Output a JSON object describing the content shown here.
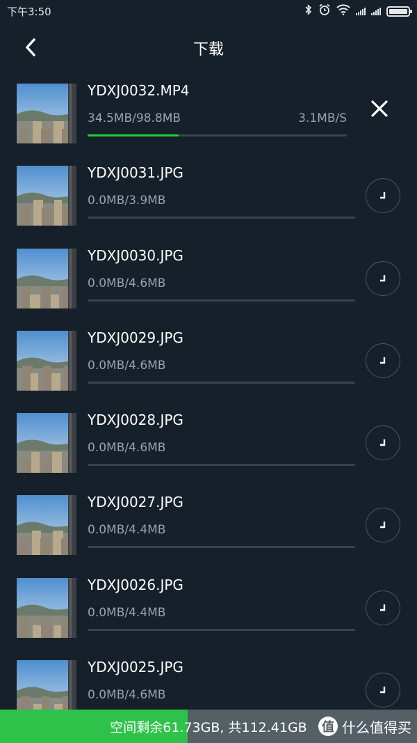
{
  "status_bar": {
    "time": "下午3:50",
    "icons": [
      "bluetooth-icon",
      "alarm-icon",
      "wifi-icon",
      "signal-icon",
      "signal-icon",
      "battery-icon"
    ]
  },
  "header": {
    "title": "下载",
    "back_icon": "chevron-left-icon"
  },
  "colors": {
    "background": "#16202a",
    "progress": "#27c93f",
    "storage_used": "#2ec24a",
    "storage_free": "#555f66"
  },
  "downloads": [
    {
      "name": "YDXJ0032.MP4",
      "size": "34.5MB/98.8MB",
      "speed": "3.1MB/S",
      "progress": 0.35,
      "state": "downloading",
      "action_icon": "close-icon"
    },
    {
      "name": "YDXJ0031.JPG",
      "size": "0.0MB/3.9MB",
      "progress": 0,
      "state": "waiting",
      "action_icon": "clock-icon"
    },
    {
      "name": "YDXJ0030.JPG",
      "size": "0.0MB/4.6MB",
      "progress": 0,
      "state": "waiting",
      "action_icon": "clock-icon"
    },
    {
      "name": "YDXJ0029.JPG",
      "size": "0.0MB/4.6MB",
      "progress": 0,
      "state": "waiting",
      "action_icon": "clock-icon"
    },
    {
      "name": "YDXJ0028.JPG",
      "size": "0.0MB/4.6MB",
      "progress": 0,
      "state": "waiting",
      "action_icon": "clock-icon"
    },
    {
      "name": "YDXJ0027.JPG",
      "size": "0.0MB/4.4MB",
      "progress": 0,
      "state": "waiting",
      "action_icon": "clock-icon"
    },
    {
      "name": "YDXJ0026.JPG",
      "size": "0.0MB/4.4MB",
      "progress": 0,
      "state": "waiting",
      "action_icon": "clock-icon"
    },
    {
      "name": "YDXJ0025.JPG",
      "size": "0.0MB/4.6MB",
      "progress": 0,
      "state": "waiting",
      "action_icon": "clock-icon"
    }
  ],
  "storage": {
    "text": "空间剩余61.73GB, 共112.41GB",
    "used_fraction": 0.45
  },
  "watermark": {
    "logo_text": "值",
    "text": "什么值得买"
  }
}
